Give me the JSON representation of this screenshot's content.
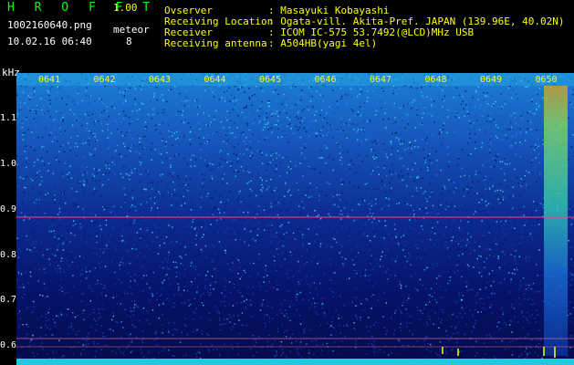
{
  "header": {
    "app_name": "H R O F F T",
    "version": "1.00",
    "filename": "1002160640.png",
    "meteor_label": "meteor",
    "datetime": "10.02.16 06:40",
    "meteor_count": "8",
    "info": [
      {
        "label": "Ovserver",
        "value": ": Masayuki Kobayashi"
      },
      {
        "label": "Receiving Location",
        "value": ": Ogata-vill. Akita-Pref. JAPAN (139.96E, 40.02N)"
      },
      {
        "label": "Receiver",
        "value": ": ICOM IC-575 53.7492(@LCD)MHz USB"
      },
      {
        "label": "Receiving antenna",
        "value": ": A504HB(yagi 4el)"
      }
    ]
  },
  "spectrogram": {
    "y_unit": "kHz",
    "y_ticks": [
      "1.1",
      "1.0",
      "0.9",
      "0.8",
      "0.7",
      "0.6"
    ],
    "x_ticks": [
      "0641",
      "0642",
      "0643",
      "0644",
      "0645",
      "0646",
      "0647",
      "0648",
      "0649",
      "0650"
    ],
    "colors": {
      "tick_text": "#ffff00",
      "ref_line": "#ff3b80",
      "label": "#ffffff"
    }
  }
}
